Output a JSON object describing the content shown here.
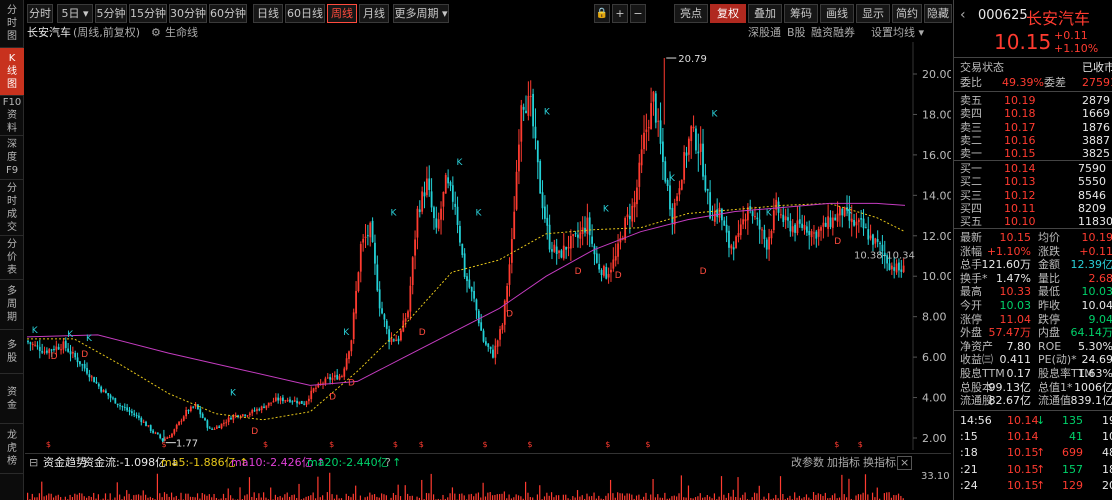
{
  "left_nav": [
    {
      "label": "分\n时\n图",
      "active": false
    },
    {
      "label": "K\n线\n图",
      "active": true
    },
    {
      "label": "F10\n资\n料",
      "active": false
    },
    {
      "label": "深\n度\nF9",
      "active": false
    },
    {
      "label": "分\n时\n成\n交",
      "active": false
    },
    {
      "label": "分\n价\n表",
      "active": false
    },
    {
      "label": "多\n周\n期",
      "active": false
    },
    {
      "label": "多\n股",
      "active": false
    },
    {
      "label": "资\n金",
      "active": false
    },
    {
      "label": "龙\n虎\n榜",
      "active": false
    }
  ],
  "toolbar": {
    "periods": [
      "分时",
      "5日",
      "5分钟",
      "15分钟",
      "30分钟",
      "60分钟",
      "日线",
      "60日线",
      "周线",
      "月线",
      "更多周期"
    ],
    "active_period": "周线",
    "right": [
      "亮点",
      "复权",
      "叠加",
      "筹码",
      "画线",
      "显示",
      "简约",
      "隐藏"
    ],
    "five_day_arrow": "▾",
    "more_arrow": "▾",
    "lock_icon": "🔒",
    "plus_label": "+",
    "minus_label": "−",
    "close_label": "×"
  },
  "subbar": {
    "stock_name": "长安汽车",
    "mode": "(周线,前复权)",
    "gear_label": "⚙",
    "ma_label": "生命线",
    "right_links": [
      "深股通",
      "B股",
      "融资融券",
      "设置均线 ▾"
    ]
  },
  "chart": {
    "high_label": "20.79",
    "low_label": "1.77",
    "last_label": "10.38-10.34",
    "y_ticks": [
      "20.00",
      "18.00",
      "16.00",
      "14.00",
      "12.00",
      "10.00",
      "8.00",
      "6.00",
      "4.00",
      "2.00"
    ]
  },
  "chart_data": {
    "type": "candlestick",
    "ylim": [
      1.5,
      21.5
    ],
    "y_ticks": [
      20,
      18,
      16,
      14,
      12,
      10,
      8,
      6,
      4,
      2
    ],
    "close_path": [
      [
        0,
        6.8
      ],
      [
        8,
        6.3
      ],
      [
        16,
        6.6
      ],
      [
        24,
        5.6
      ],
      [
        32,
        4.4
      ],
      [
        40,
        3.6
      ],
      [
        48,
        3.0
      ],
      [
        54,
        2.3
      ],
      [
        58,
        1.9
      ],
      [
        62,
        2.2
      ],
      [
        68,
        3.3
      ],
      [
        72,
        3.6
      ],
      [
        78,
        2.4
      ],
      [
        82,
        2.6
      ],
      [
        88,
        3.1
      ],
      [
        94,
        3.2
      ],
      [
        100,
        3.5
      ],
      [
        106,
        3.9
      ],
      [
        112,
        3.9
      ],
      [
        118,
        3.7
      ],
      [
        122,
        4.4
      ],
      [
        128,
        4.9
      ],
      [
        134,
        5.1
      ],
      [
        138,
        6.9
      ],
      [
        142,
        11.5
      ],
      [
        146,
        12.3
      ],
      [
        150,
        8.6
      ],
      [
        154,
        6.9
      ],
      [
        158,
        6.9
      ],
      [
        162,
        8.3
      ],
      [
        166,
        13.2
      ],
      [
        170,
        14.6
      ],
      [
        174,
        12.1
      ],
      [
        178,
        14.6
      ],
      [
        182,
        13.6
      ],
      [
        186,
        10.1
      ],
      [
        190,
        8.8
      ],
      [
        194,
        6.8
      ],
      [
        198,
        6.1
      ],
      [
        202,
        7.6
      ],
      [
        206,
        11.6
      ],
      [
        210,
        18.8
      ],
      [
        214,
        18.4
      ],
      [
        218,
        14.3
      ],
      [
        222,
        11.6
      ],
      [
        226,
        11.0
      ],
      [
        230,
        11.6
      ],
      [
        234,
        11.9
      ],
      [
        238,
        12.6
      ],
      [
        242,
        10.6
      ],
      [
        246,
        10.1
      ],
      [
        250,
        10.9
      ],
      [
        254,
        12.6
      ],
      [
        258,
        13.6
      ],
      [
        262,
        16.8
      ],
      [
        266,
        18.8
      ],
      [
        270,
        15.6
      ],
      [
        274,
        13.0
      ],
      [
        278,
        15.2
      ],
      [
        282,
        17.2
      ],
      [
        286,
        16.1
      ],
      [
        290,
        13.1
      ],
      [
        294,
        13.2
      ],
      [
        298,
        11.5
      ],
      [
        302,
        11.8
      ],
      [
        306,
        13.6
      ],
      [
        310,
        12.6
      ],
      [
        314,
        11.6
      ],
      [
        318,
        13.4
      ],
      [
        322,
        12.6
      ],
      [
        326,
        12.4
      ],
      [
        330,
        12.5
      ],
      [
        334,
        12.1
      ],
      [
        338,
        12.4
      ],
      [
        342,
        12.8
      ],
      [
        346,
        13.2
      ],
      [
        350,
        12.6
      ],
      [
        354,
        12.5
      ],
      [
        358,
        11.9
      ],
      [
        362,
        11.4
      ],
      [
        366,
        10.6
      ],
      [
        370,
        10.3
      ]
    ],
    "x_range": [
      0,
      372
    ],
    "ma_yellow": [
      [
        0,
        6.9
      ],
      [
        20,
        6.9
      ],
      [
        40,
        5.6
      ],
      [
        60,
        4.2
      ],
      [
        80,
        3.2
      ],
      [
        100,
        2.9
      ],
      [
        120,
        3.3
      ],
      [
        140,
        5.3
      ],
      [
        160,
        7.6
      ],
      [
        180,
        10.2
      ],
      [
        200,
        10.8
      ],
      [
        220,
        12.1
      ],
      [
        240,
        12.3
      ],
      [
        260,
        12.4
      ],
      [
        280,
        13.1
      ],
      [
        300,
        13.3
      ],
      [
        320,
        13.5
      ],
      [
        340,
        13.6
      ],
      [
        360,
        12.9
      ],
      [
        372,
        12.2
      ]
    ],
    "ma_magenta": [
      [
        0,
        7.0
      ],
      [
        30,
        7.1
      ],
      [
        60,
        6.2
      ],
      [
        90,
        5.4
      ],
      [
        120,
        4.6
      ],
      [
        140,
        4.8
      ],
      [
        160,
        6.0
      ],
      [
        180,
        7.2
      ],
      [
        200,
        8.4
      ],
      [
        220,
        10.0
      ],
      [
        240,
        11.3
      ],
      [
        260,
        12.2
      ],
      [
        280,
        12.8
      ],
      [
        300,
        13.2
      ],
      [
        320,
        13.4
      ],
      [
        340,
        13.6
      ],
      [
        360,
        13.6
      ],
      [
        372,
        13.5
      ]
    ],
    "markers": [
      {
        "label": "K",
        "x": 2,
        "y": 7.2
      },
      {
        "label": "D",
        "x": 10,
        "y": 5.9
      },
      {
        "label": "K",
        "x": 17,
        "y": 7.0
      },
      {
        "label": "D",
        "x": 23,
        "y": 6.0
      },
      {
        "label": "K",
        "x": 25,
        "y": 6.8
      },
      {
        "label": "K",
        "x": 86,
        "y": 4.1
      },
      {
        "label": "D",
        "x": 95,
        "y": 2.2
      },
      {
        "label": "D",
        "x": 128,
        "y": 3.9
      },
      {
        "label": "K",
        "x": 134,
        "y": 7.1
      },
      {
        "label": "D",
        "x": 136,
        "y": 4.6
      },
      {
        "label": "K",
        "x": 154,
        "y": 13.0
      },
      {
        "label": "D",
        "x": 166,
        "y": 7.1
      },
      {
        "label": "K",
        "x": 182,
        "y": 15.5
      },
      {
        "label": "K",
        "x": 190,
        "y": 13.0
      },
      {
        "label": "D",
        "x": 203,
        "y": 8.0
      },
      {
        "label": "K",
        "x": 219,
        "y": 18.0
      },
      {
        "label": "D",
        "x": 232,
        "y": 10.1
      },
      {
        "label": "K",
        "x": 244,
        "y": 13.2
      },
      {
        "label": "D",
        "x": 249,
        "y": 9.9
      },
      {
        "label": "K",
        "x": 272,
        "y": 14.7
      },
      {
        "label": "D",
        "x": 285,
        "y": 10.1
      },
      {
        "label": "K",
        "x": 290,
        "y": 17.9
      },
      {
        "label": "K",
        "x": 313,
        "y": 13.0
      },
      {
        "label": "K",
        "x": 347,
        "y": 13.1
      },
      {
        "label": "D",
        "x": 342,
        "y": 11.6
      }
    ],
    "s_markers": [
      8,
      57,
      100,
      128,
      155,
      166,
      193,
      212,
      245,
      262,
      342,
      352
    ]
  },
  "indicator_bar": {
    "tab": "资金趋势",
    "flow": "资金流:-1.098亿 ↓",
    "ma5": "ma5:-1.886亿 ↑",
    "ma10": "ma10:-2.426亿 ↑",
    "ma20": "ma20:-2.440亿 ↑",
    "right": [
      "改参数",
      "加指标",
      "换指标"
    ],
    "scale": "33.10",
    "toggle_icon": "⊟",
    "help_icon": "?"
  },
  "right_panel": {
    "code": "000625",
    "name": "长安汽车",
    "price": "10.15",
    "change": "+0.11",
    "change_pct": "+1.10%",
    "status_label": "交易状态",
    "status_value": "已收市",
    "weibi_label": "委比",
    "weibi_value": "49.39%",
    "weicha_label": "委差",
    "weicha_value": "27591",
    "asks": [
      {
        "label": "卖五",
        "price": "10.19",
        "vol": "2879"
      },
      {
        "label": "卖四",
        "price": "10.18",
        "vol": "1669"
      },
      {
        "label": "卖三",
        "price": "10.17",
        "vol": "1876"
      },
      {
        "label": "卖二",
        "price": "10.16",
        "vol": "3887"
      },
      {
        "label": "卖一",
        "price": "10.15",
        "vol": "3825"
      }
    ],
    "bids": [
      {
        "label": "买一",
        "price": "10.14",
        "vol": "7590"
      },
      {
        "label": "买二",
        "price": "10.13",
        "vol": "5550"
      },
      {
        "label": "买三",
        "price": "10.12",
        "vol": "8546"
      },
      {
        "label": "买四",
        "price": "10.11",
        "vol": "8209"
      },
      {
        "label": "买五",
        "price": "10.10",
        "vol": "11830"
      }
    ],
    "stats": [
      {
        "l1": "最新",
        "v1": "10.15",
        "c1": "red",
        "l2": "均价",
        "v2": "10.19",
        "c2": "red"
      },
      {
        "l1": "涨幅",
        "v1": "+1.10%",
        "c1": "red",
        "l2": "涨跌",
        "v2": "+0.11",
        "c2": "red"
      },
      {
        "l1": "总手",
        "v1": "121.60万",
        "c1": "white",
        "l2": "金额",
        "v2": "12.39亿",
        "c2": "cyan"
      },
      {
        "l1": "换手*",
        "v1": "1.47%",
        "c1": "white",
        "l2": "量比",
        "v2": "2.68",
        "c2": "red"
      },
      {
        "l1": "最高",
        "v1": "10.33",
        "c1": "red",
        "l2": "最低",
        "v2": "10.03",
        "c2": "green"
      },
      {
        "l1": "今开",
        "v1": "10.03",
        "c1": "green",
        "l2": "昨收",
        "v2": "10.04",
        "c2": "white"
      },
      {
        "l1": "涨停",
        "v1": "11.04",
        "c1": "red",
        "l2": "跌停",
        "v2": "9.04",
        "c2": "green"
      },
      {
        "l1": "外盘",
        "v1": "57.47万",
        "c1": "red",
        "l2": "内盘",
        "v2": "64.14万",
        "c2": "green"
      },
      {
        "l1": "净资产",
        "v1": "7.80",
        "c1": "white",
        "l2": "ROE",
        "v2": "5.30%",
        "c2": "white"
      },
      {
        "l1": "收益㈢",
        "v1": "0.411",
        "c1": "white",
        "l2": "PE(动)*",
        "v2": "24.69",
        "c2": "white"
      },
      {
        "l1": "股息TTM",
        "v1": "0.17",
        "c1": "white",
        "l2": "股息率TTM",
        "v2": "1.63%",
        "c2": "white"
      },
      {
        "l1": "总股本",
        "v1": "99.13亿",
        "c1": "white",
        "l2": "总值1*",
        "v2": "1006亿",
        "c2": "white"
      },
      {
        "l1": "流通股",
        "v1": "82.67亿",
        "c1": "white",
        "l2": "流通值",
        "v2": "839.1亿",
        "c2": "white"
      }
    ],
    "ticks": [
      {
        "time": "14:56",
        "price": "10.14",
        "dir": "↓",
        "vol": "135",
        "dcolor": "green",
        "vcolor": "green",
        "extra": "19"
      },
      {
        "time": ":15",
        "price": "10.14",
        "dir": "",
        "vol": "41",
        "dcolor": "",
        "vcolor": "green",
        "extra": "10"
      },
      {
        "time": ":18",
        "price": "10.15",
        "dir": "↑",
        "vol": "699",
        "dcolor": "red",
        "vcolor": "red",
        "extra": "48"
      },
      {
        "time": ":21",
        "price": "10.15",
        "dir": "↑",
        "vol": "157",
        "dcolor": "red",
        "vcolor": "green",
        "extra": "18"
      },
      {
        "time": ":24",
        "price": "10.15",
        "dir": "↑",
        "vol": "129",
        "dcolor": "red",
        "vcolor": "red",
        "extra": "20"
      }
    ]
  }
}
